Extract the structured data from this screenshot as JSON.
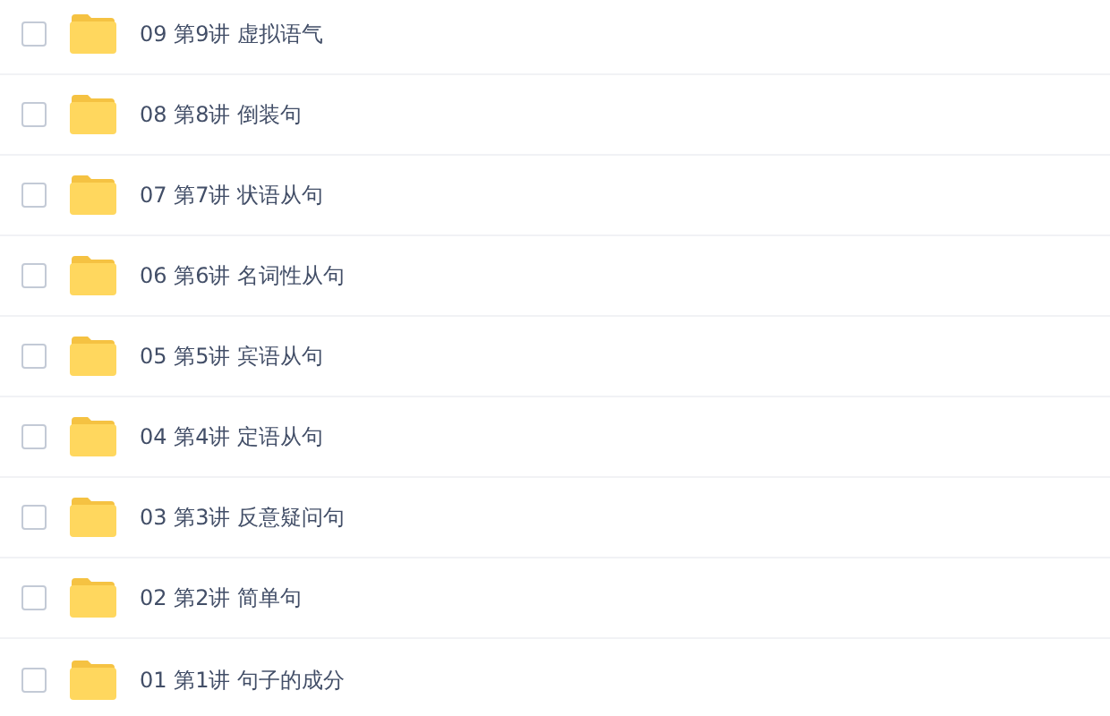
{
  "files": [
    {
      "name": "09 第9讲 虚拟语气",
      "checked": false
    },
    {
      "name": "08 第8讲 倒装句",
      "checked": false
    },
    {
      "name": "07 第7讲 状语从句",
      "checked": false
    },
    {
      "name": "06 第6讲 名词性从句",
      "checked": false
    },
    {
      "name": "05 第5讲 宾语从句",
      "checked": false
    },
    {
      "name": "04 第4讲 定语从句",
      "checked": false
    },
    {
      "name": "03 第3讲 反意疑问句",
      "checked": false
    },
    {
      "name": "02 第2讲 简单句",
      "checked": false
    },
    {
      "name": "01 第1讲 句子的成分",
      "checked": false
    }
  ]
}
